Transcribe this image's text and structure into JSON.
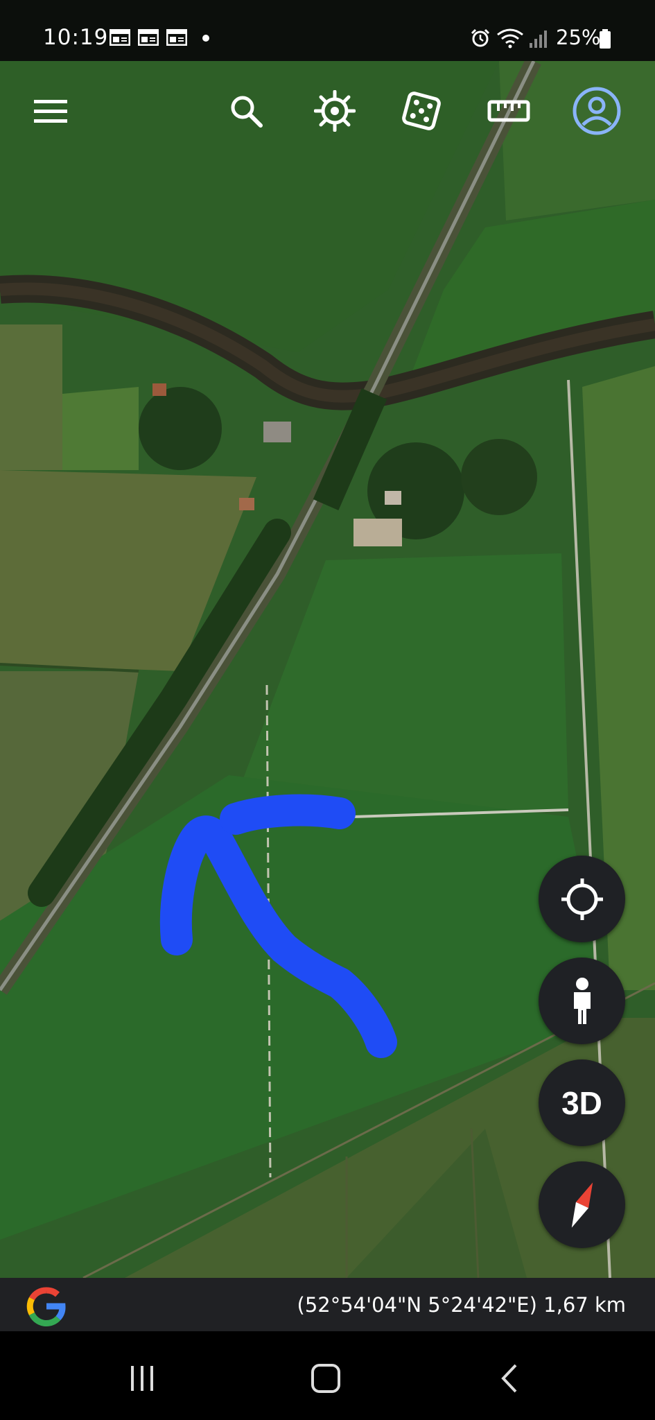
{
  "status_bar": {
    "time": "10:19",
    "battery": "25%",
    "icons": [
      "gallery-notif-icon",
      "gallery-notif-icon",
      "gallery-notif-icon",
      "alarm-icon",
      "wifi-icon",
      "signal-icon",
      "battery-icon"
    ]
  },
  "toolbar": {
    "items": [
      "menu-icon",
      "search-icon",
      "voyager-icon",
      "feeling-lucky-icon",
      "measure-icon",
      "account-icon"
    ]
  },
  "map_controls": {
    "three_d_label": "3D"
  },
  "bottom_bar": {
    "coordinates": "(52°54'04\"N 5°24'42\"E) 1,67 km"
  },
  "colors": {
    "accent": "#8ab4f8",
    "drawing_stroke": "#1f4cf5",
    "fab_bg": "#1f2125",
    "compass_red": "#ea4335"
  }
}
